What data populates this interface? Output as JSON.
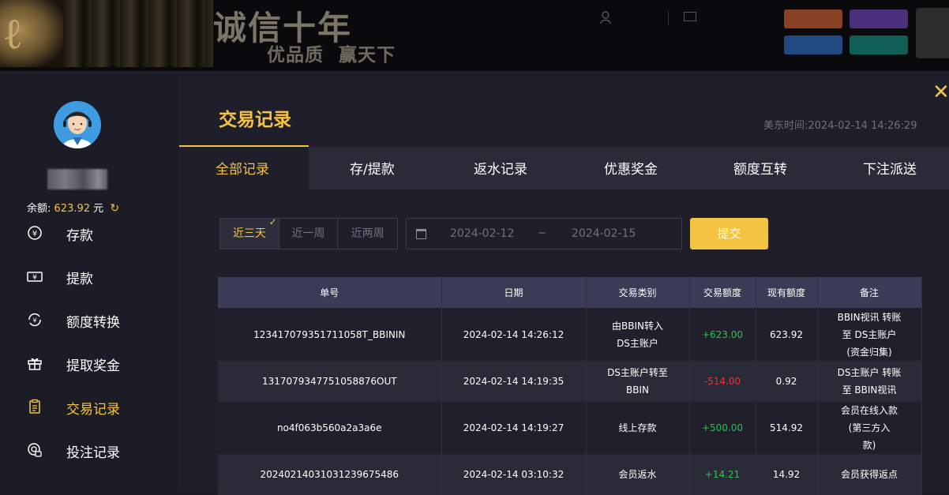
{
  "header": {
    "slogan_main": "诚信十年",
    "slogan_sub": "优品质 赢天下"
  },
  "sidebar": {
    "balance_label": "余额:",
    "balance_value": "623.92",
    "balance_unit": "元",
    "menu": [
      {
        "label": "存款",
        "icon": "deposit-icon"
      },
      {
        "label": "提款",
        "icon": "withdraw-icon"
      },
      {
        "label": "额度转换",
        "icon": "transfer-icon"
      },
      {
        "label": "提取奖金",
        "icon": "gift-icon"
      },
      {
        "label": "交易记录",
        "icon": "records-icon",
        "active": true
      },
      {
        "label": "投注记录",
        "icon": "bet-records-icon"
      }
    ]
  },
  "main": {
    "title": "交易记录",
    "time_label": "美东时间:",
    "time_value": "2024-02-14 14:26:29",
    "tabs": [
      "全部记录",
      "存/提款",
      "返水记录",
      "优惠奖金",
      "额度互转",
      "下注派送"
    ],
    "active_tab": 0,
    "range_buttons": [
      "近三天",
      "近一周",
      "近两周"
    ],
    "active_range": 0,
    "date_from": "2024-02-12",
    "date_separator": "~",
    "date_to": "2024-02-15",
    "submit_label": "提交"
  },
  "table": {
    "headers": [
      "单号",
      "日期",
      "交易类别",
      "交易额度",
      "现有额度",
      "备注"
    ],
    "rows": [
      {
        "id": "12341707935171105­8T_BBININ",
        "date": "2024-02-14 14:26:12",
        "type_l1": "由BBIN转入",
        "type_l2": "DS主账户",
        "amount": "+623.00",
        "balance": "623.92",
        "note_l1": "BBIN视讯 转账",
        "note_l2": "至 DS主账户",
        "note_l3": "(资金归集)"
      },
      {
        "id": "1317079347751058876OUT",
        "date": "2024-02-14 14:19:35",
        "type_l1": "DS主账户转至",
        "type_l2": "BBIN",
        "amount": "-514.00",
        "balance": "0.92",
        "note_l1": "DS主账户 转账",
        "note_l2": "至 BBIN视讯",
        "note_l3": ""
      },
      {
        "id": "no4f063b560a2a3a6e",
        "date": "2024-02-14 14:19:27",
        "type_l1": "线上存款",
        "type_l2": "",
        "amount": "+500.00",
        "balance": "514.92",
        "note_l1": "会员在线入款",
        "note_l2": "(第三方入",
        "note_l3": "款)"
      },
      {
        "id": "20240214031031239675486",
        "date": "2024-02-14 03:10:32",
        "type_l1": "会员返水",
        "type_l2": "",
        "amount": "+14.21",
        "balance": "14.92",
        "note_l1": "会员获得返点",
        "note_l2": "",
        "note_l3": ""
      }
    ]
  }
}
